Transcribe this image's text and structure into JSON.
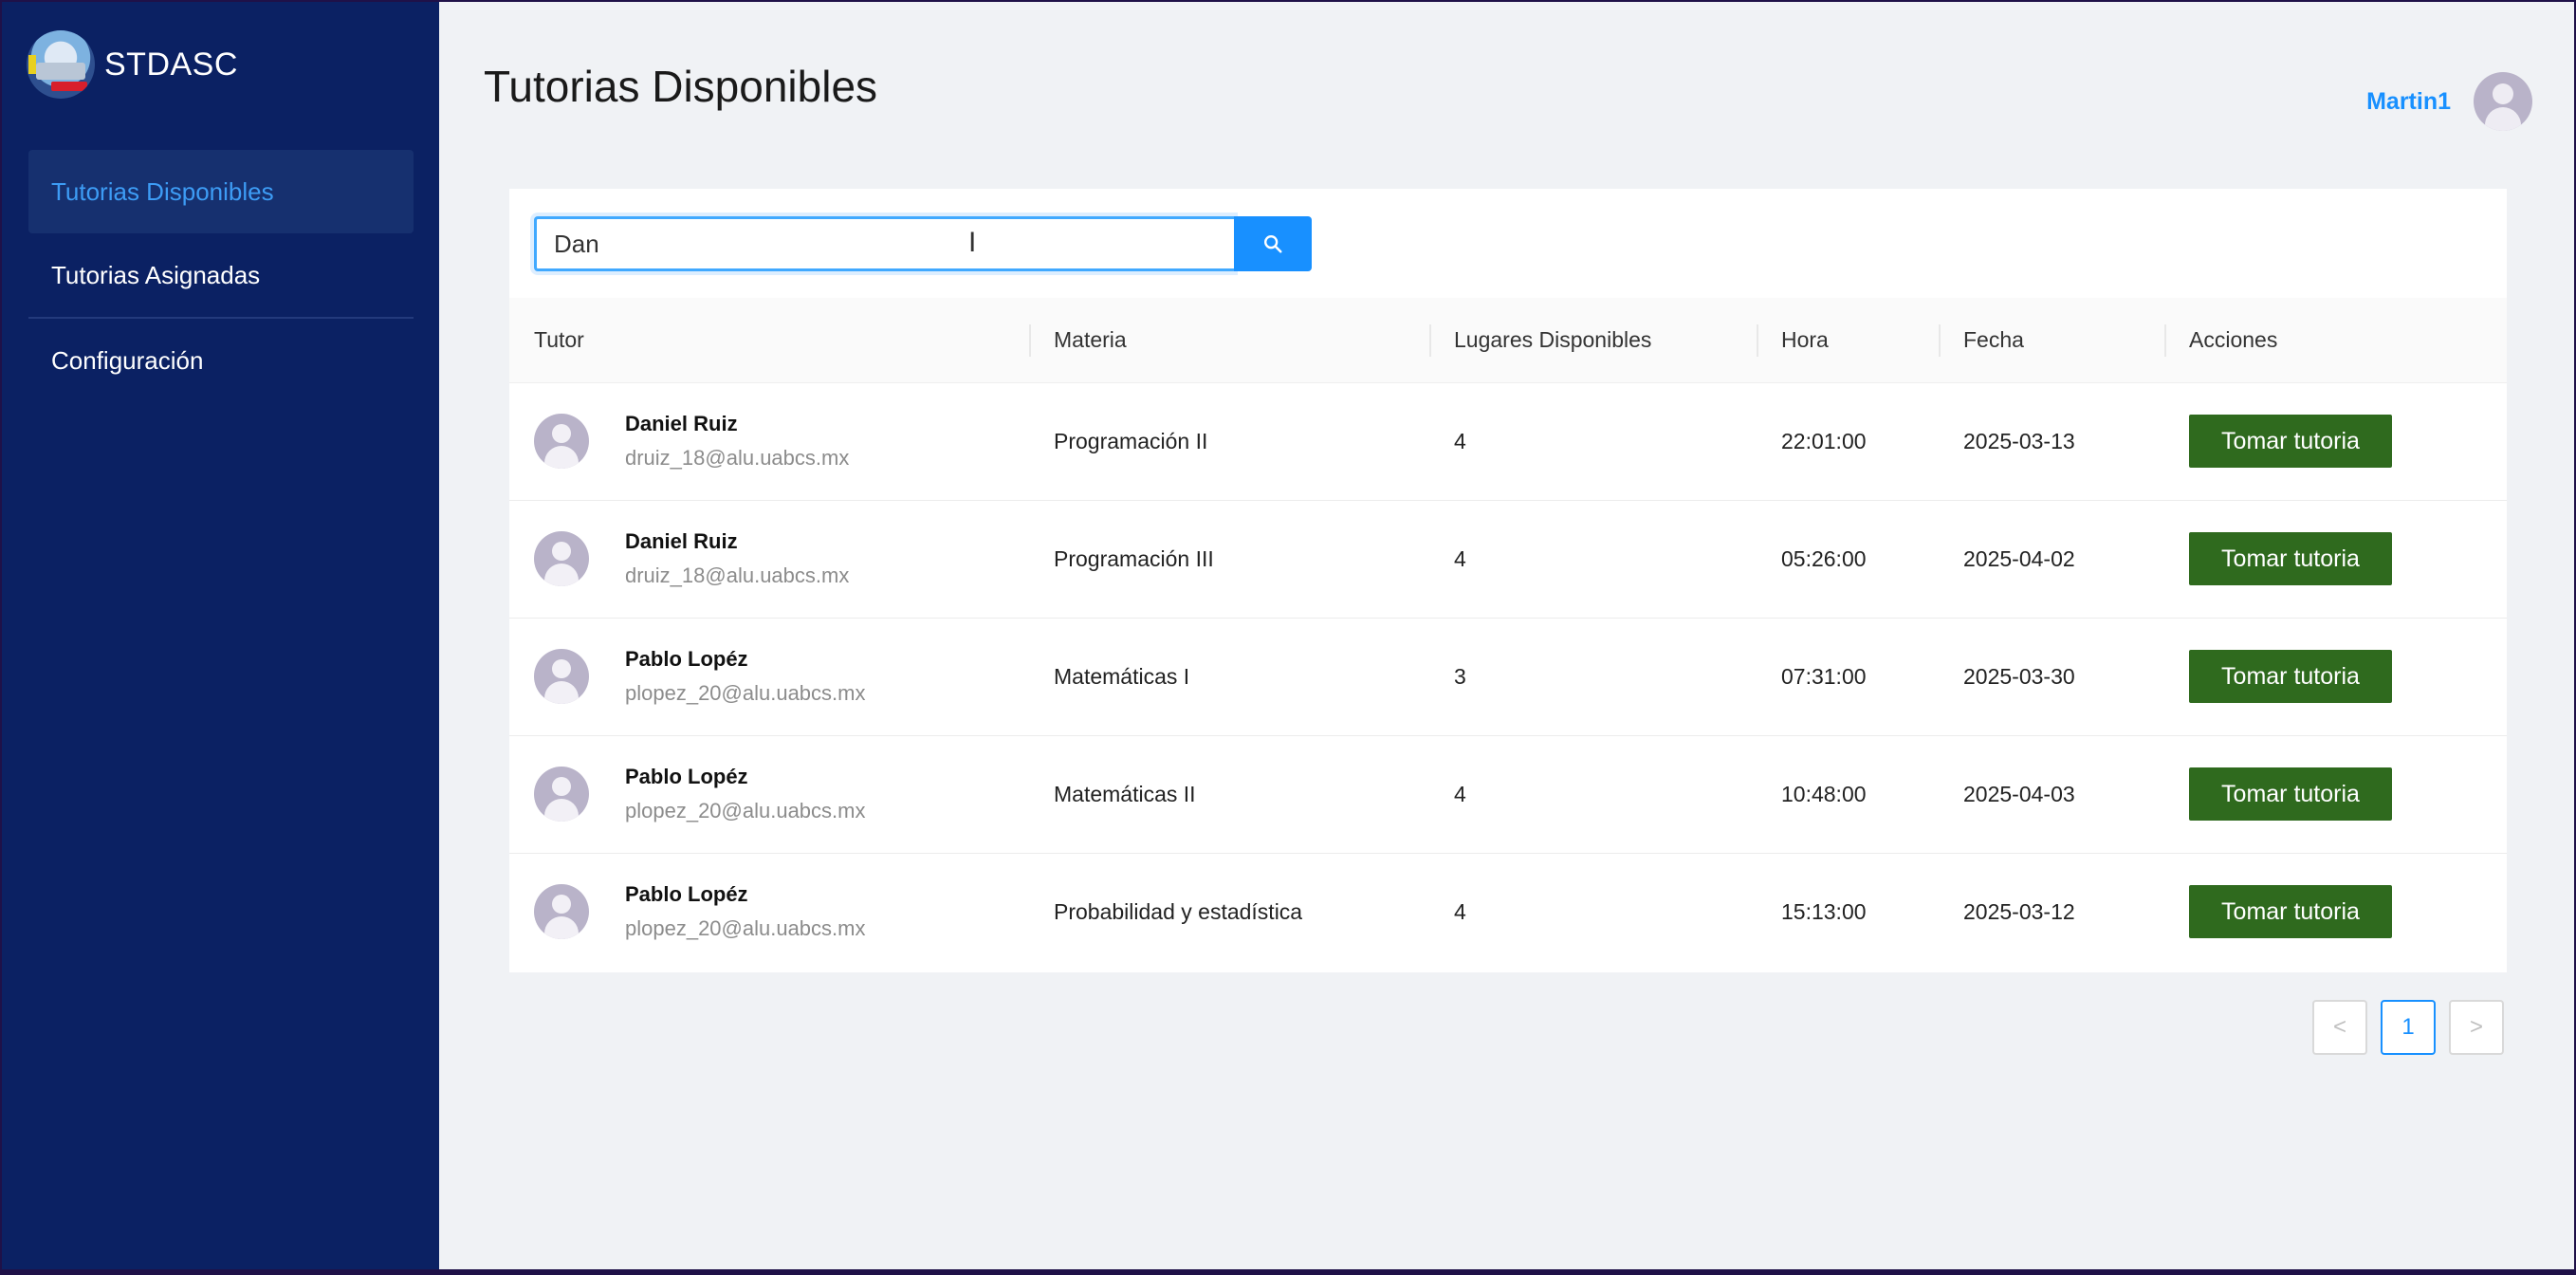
{
  "app": {
    "brand": "STDASC"
  },
  "sidebar": {
    "items": [
      {
        "label": "Tutorias Disponibles",
        "active": true
      },
      {
        "label": "Tutorias Asignadas"
      },
      {
        "label": "Configuración"
      }
    ]
  },
  "header": {
    "title": "Tutorias Disponibles",
    "user": "Martin1"
  },
  "search": {
    "value": "Dan",
    "icon": "search-icon"
  },
  "table": {
    "columns": [
      "Tutor",
      "Materia",
      "Lugares Disponibles",
      "Hora",
      "Fecha",
      "Acciones"
    ],
    "rows": [
      {
        "name": "Daniel Ruiz",
        "email": "druiz_18@alu.uabcs.mx",
        "materia": "Programación II",
        "lugares": "4",
        "hora": "22:01:00",
        "fecha": "2025-03-13",
        "action": "Tomar tutoria"
      },
      {
        "name": "Daniel Ruiz",
        "email": "druiz_18@alu.uabcs.mx",
        "materia": "Programación III",
        "lugares": "4",
        "hora": "05:26:00",
        "fecha": "2025-04-02",
        "action": "Tomar tutoria"
      },
      {
        "name": "Pablo Lopéz",
        "email": "plopez_20@alu.uabcs.mx",
        "materia": "Matemáticas I",
        "lugares": "3",
        "hora": "07:31:00",
        "fecha": "2025-03-30",
        "action": "Tomar tutoria"
      },
      {
        "name": "Pablo Lopéz",
        "email": "plopez_20@alu.uabcs.mx",
        "materia": "Matemáticas II",
        "lugares": "4",
        "hora": "10:48:00",
        "fecha": "2025-04-03",
        "action": "Tomar tutoria"
      },
      {
        "name": "Pablo Lopéz",
        "email": "plopez_20@alu.uabcs.mx",
        "materia": "Probabilidad y estadística",
        "lugares": "4",
        "hora": "15:13:00",
        "fecha": "2025-03-12",
        "action": "Tomar tutoria"
      }
    ]
  },
  "pagination": {
    "prev": "<",
    "current": "1",
    "next": ">"
  },
  "colors": {
    "sidebar": "#0b2163",
    "accent": "#1890ff",
    "action": "#2f6a1e"
  }
}
